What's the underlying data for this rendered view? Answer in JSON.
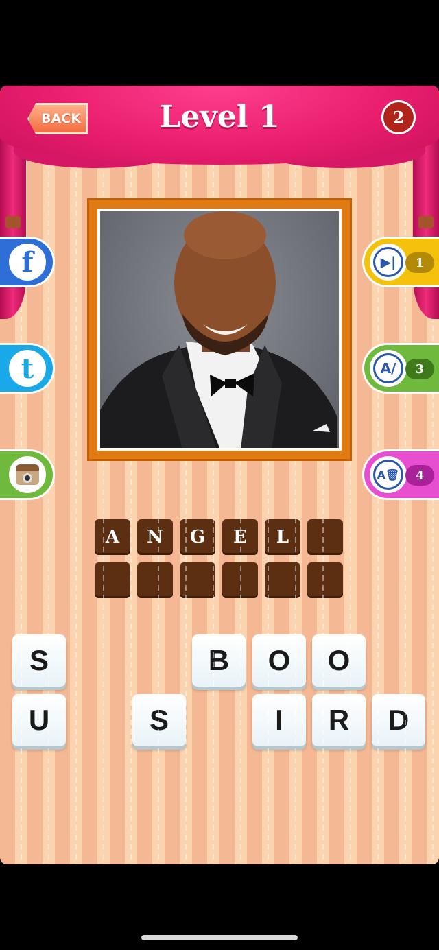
{
  "header": {
    "back_label": "BACK",
    "level_title": "Level 1",
    "coins": "2"
  },
  "social": [
    {
      "name": "facebook",
      "glyph": "f",
      "color": "#2d6fd6"
    },
    {
      "name": "twitter",
      "glyph": "t",
      "color": "#19a9e8"
    },
    {
      "name": "instagram",
      "glyph": "",
      "color": "#6fb93c"
    }
  ],
  "hints": [
    {
      "name": "skip",
      "count": "1",
      "color": "#f4c20d",
      "count_color": "#b38a08"
    },
    {
      "name": "reveal-letter",
      "count": "3",
      "color": "#6fb93c",
      "count_color": "#3f7a1a"
    },
    {
      "name": "remove-letters",
      "count": "4",
      "color": "#e84fd0",
      "count_color": "#a9229a"
    }
  ],
  "answer": {
    "row1": [
      "A",
      "N",
      "G",
      "E",
      "L",
      ""
    ],
    "row2": [
      "",
      "",
      "",
      "",
      "",
      ""
    ]
  },
  "keys": {
    "row1": [
      "S",
      "",
      "",
      "B",
      "O",
      "O",
      ""
    ],
    "row2": [
      "U",
      "",
      "S",
      "",
      "I",
      "R",
      "D"
    ]
  }
}
